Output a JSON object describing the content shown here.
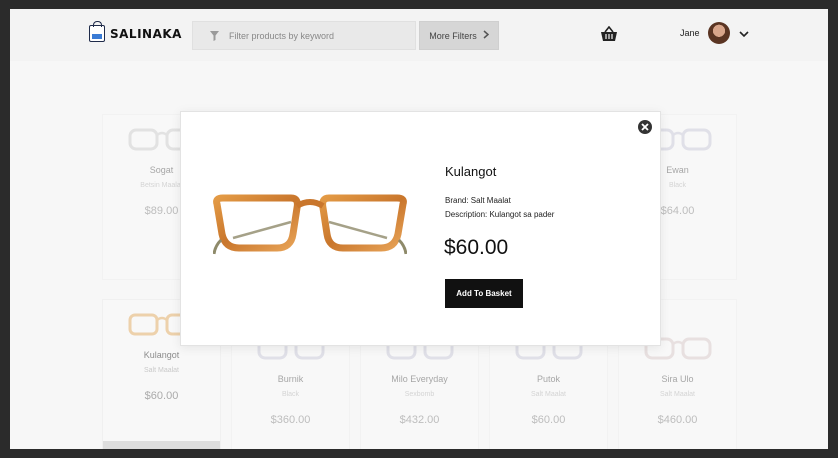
{
  "header": {
    "brand": "SALINAKA",
    "search_placeholder": "Filter products by keyword",
    "more_filters_label": "More Filters",
    "user_name": "Jane"
  },
  "products": [
    {
      "name": "Sogat",
      "brand": "Betsin Maalat",
      "price": "$89.00"
    },
    {
      "name": "Ewan",
      "brand": "Black",
      "price": "$64.00"
    },
    {
      "name": "Kulangot",
      "brand": "Salt Maalat",
      "price": "$60.00"
    },
    {
      "name": "Burnik",
      "brand": "Black",
      "price": "$360.00"
    },
    {
      "name": "Milo Everyday",
      "brand": "Sexbomb",
      "price": "$432.00"
    },
    {
      "name": "Putok",
      "brand": "Salt Maalat",
      "price": "$60.00"
    },
    {
      "name": "Sira Ulo",
      "brand": "Salt Maalat",
      "price": "$460.00"
    }
  ],
  "modal": {
    "title": "Kulangot",
    "brand": "Brand: Salt Maalat",
    "description": "Description: Kulangot sa pader",
    "price": "$60.00",
    "add_label": "Add To Basket"
  },
  "colors": {
    "accent": "#111111",
    "frame_orange": "#d98a3a",
    "temple_olive": "#8e8a6a",
    "logo_blue": "#3a7bd5"
  }
}
